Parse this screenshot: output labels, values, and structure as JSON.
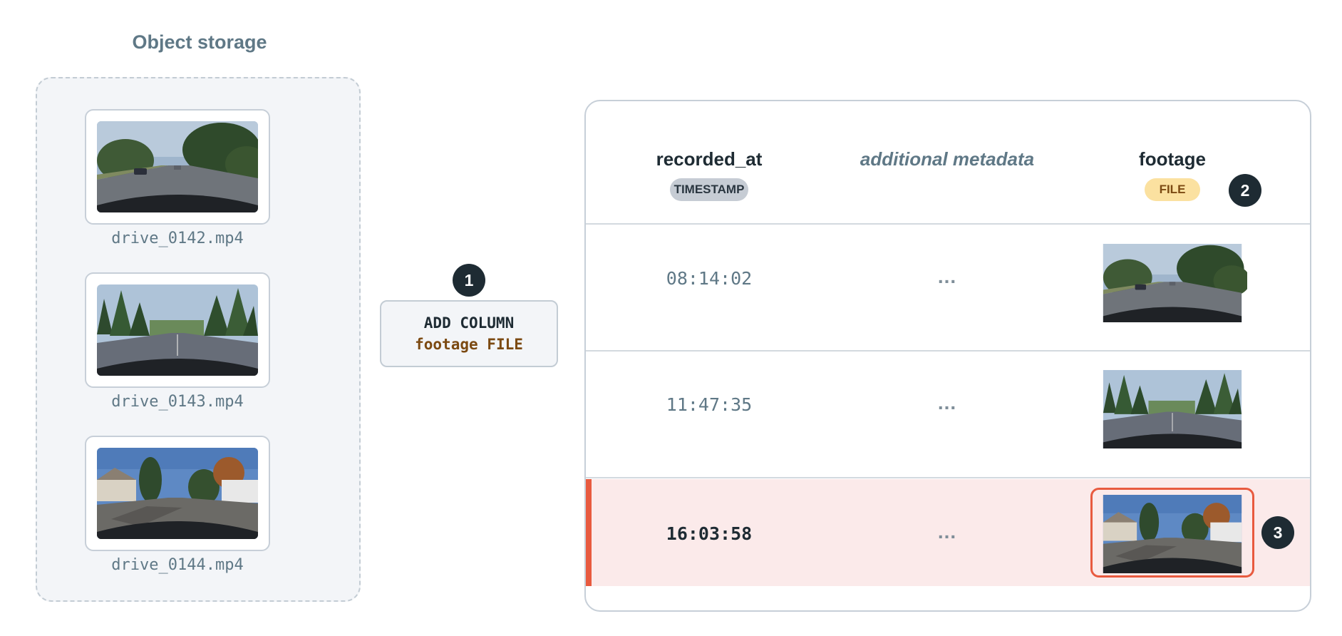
{
  "storage": {
    "title": "Object storage",
    "files": [
      {
        "name": "drive_0142.mp4",
        "scene": "street-trees"
      },
      {
        "name": "drive_0143.mp4",
        "scene": "forest-road"
      },
      {
        "name": "drive_0144.mp4",
        "scene": "suburb-houses"
      }
    ]
  },
  "steps": {
    "one": "1",
    "two": "2",
    "three": "3"
  },
  "sql": {
    "keyword": "ADD COLUMN",
    "column": "footage",
    "type": "FILE"
  },
  "table": {
    "columns": [
      {
        "label": "recorded_at",
        "type": "TIMESTAMP"
      },
      {
        "label": "additional metadata"
      },
      {
        "label": "footage",
        "type": "FILE"
      }
    ],
    "rows": [
      {
        "recorded_at": "08:14:02",
        "metadata": "...",
        "footage_scene": "street-trees",
        "highlighted": false
      },
      {
        "recorded_at": "11:47:35",
        "metadata": "...",
        "footage_scene": "forest-road",
        "highlighted": false
      },
      {
        "recorded_at": "16:03:58",
        "metadata": "...",
        "footage_scene": "suburb-houses",
        "highlighted": true
      }
    ]
  },
  "colors": {
    "accent": "#e85a3f",
    "badge": "#1e2b33",
    "file_pill": "#fbe1a0",
    "timestamp_pill": "#c6ccd4",
    "highlight_row": "#fbeaea"
  }
}
